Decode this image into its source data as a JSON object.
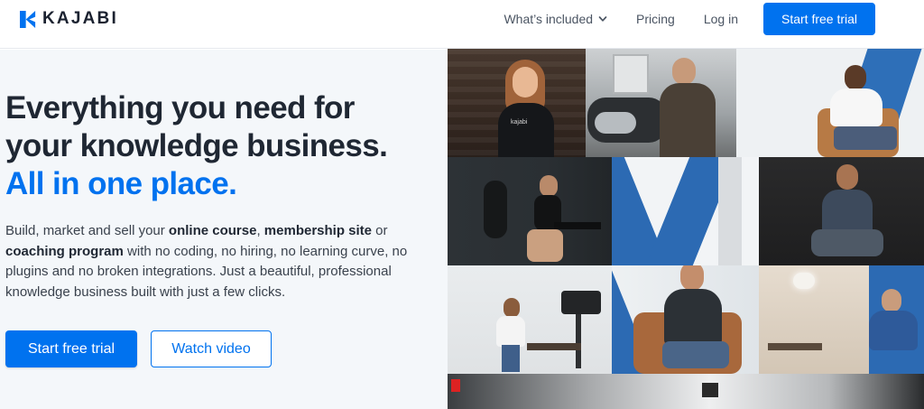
{
  "brand": {
    "name": "KAJABI",
    "accent": "#0072ef"
  },
  "nav": {
    "items": [
      {
        "label": "What’s included",
        "dropdown": true
      },
      {
        "label": "Pricing"
      },
      {
        "label": "Log in"
      }
    ],
    "cta_label": "Start free trial"
  },
  "hero": {
    "headline_line1": "Everything you need for",
    "headline_line2": "your knowledge business.",
    "headline_accent": "All in one place.",
    "body": {
      "t1": "Build, market and sell your ",
      "b1": "online course",
      "t2": ", ",
      "b2": "membership site",
      "t3": " or ",
      "b3": "coaching program",
      "t4": " with no coding, no hiring, no learning curve, no plugins and no broken integrations. Just a beautiful, professional knowledge business built with just a few clicks."
    },
    "primary_cta": "Start free trial",
    "secondary_cta": "Watch video"
  },
  "collage": {
    "photos": [
      "woman-smiling-black-tshirt",
      "man-on-motorcycle",
      "man-seated-white-shirt",
      "woman-seated-gym",
      "blue-white-wall-panel",
      "man-seated-dark-studio",
      "woman-presenting-studio",
      "man-speaking-leather-chair",
      "room-chandelier-blue-wall",
      "interior-door-sign"
    ],
    "shirt_text": "kajabi"
  }
}
